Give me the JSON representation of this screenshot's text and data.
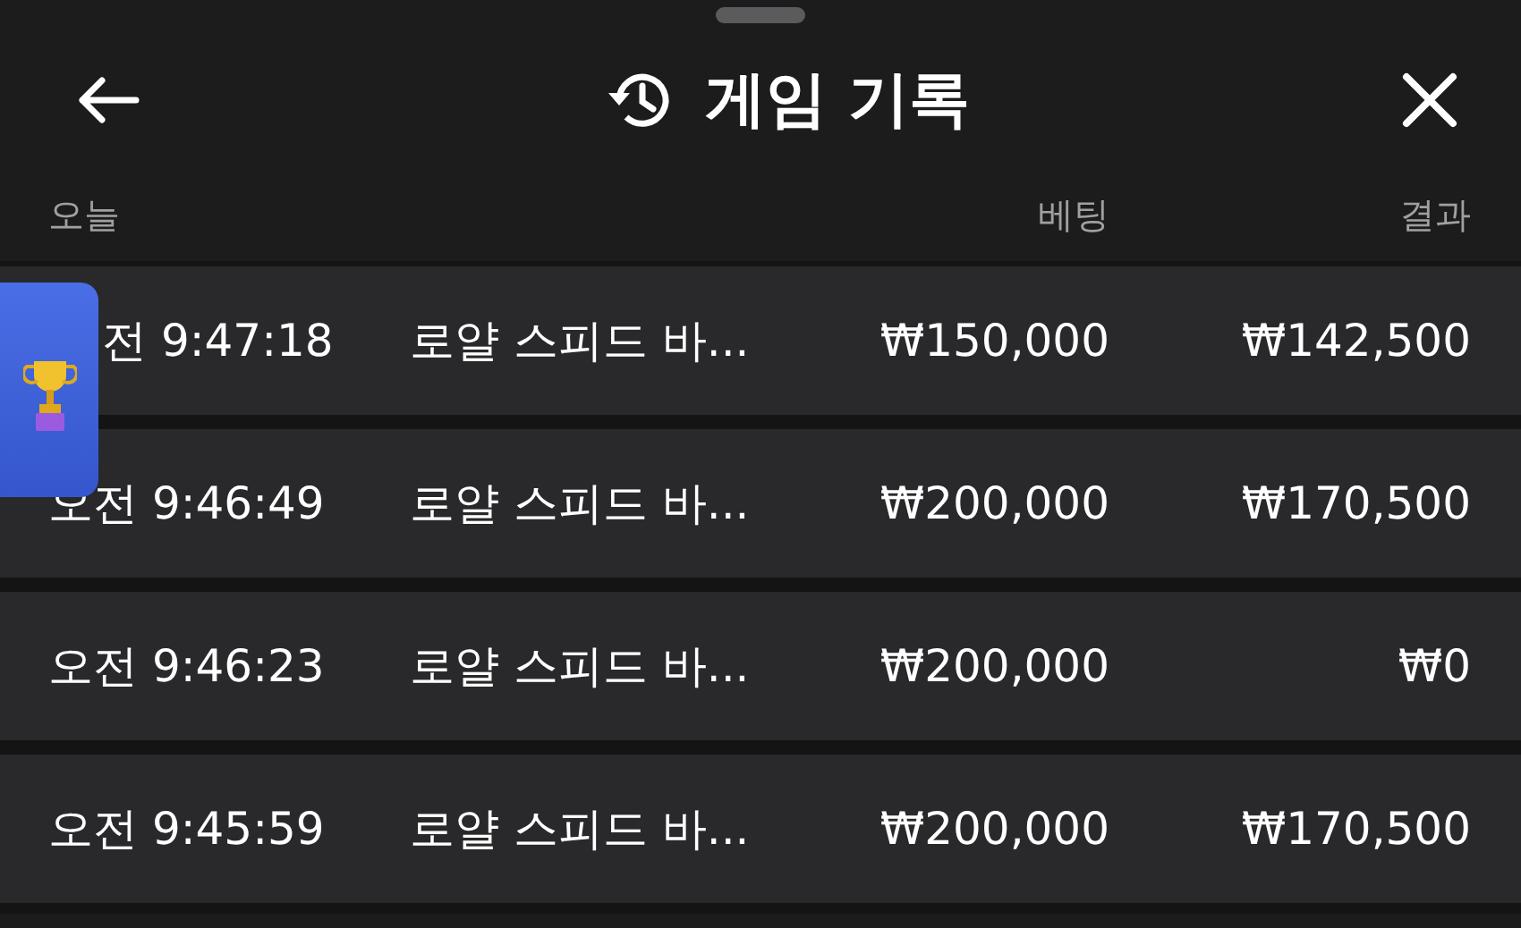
{
  "header": {
    "title": "게임 기록"
  },
  "columns": {
    "date": "오늘",
    "bet": "베팅",
    "result": "결과"
  },
  "rows": [
    {
      "time": "전 9:47:18",
      "game": "로얄 스피드 바...",
      "bet": "₩150,000",
      "result": "₩142,500"
    },
    {
      "time": "오전 9:46:49",
      "game": "로얄 스피드 바...",
      "bet": "₩200,000",
      "result": "₩170,500"
    },
    {
      "time": "오전 9:46:23",
      "game": "로얄 스피드 바...",
      "bet": "₩200,000",
      "result": "₩0"
    },
    {
      "time": "오전 9:45:59",
      "game": "로얄 스피드 바...",
      "bet": "₩200,000",
      "result": "₩170,500"
    }
  ]
}
